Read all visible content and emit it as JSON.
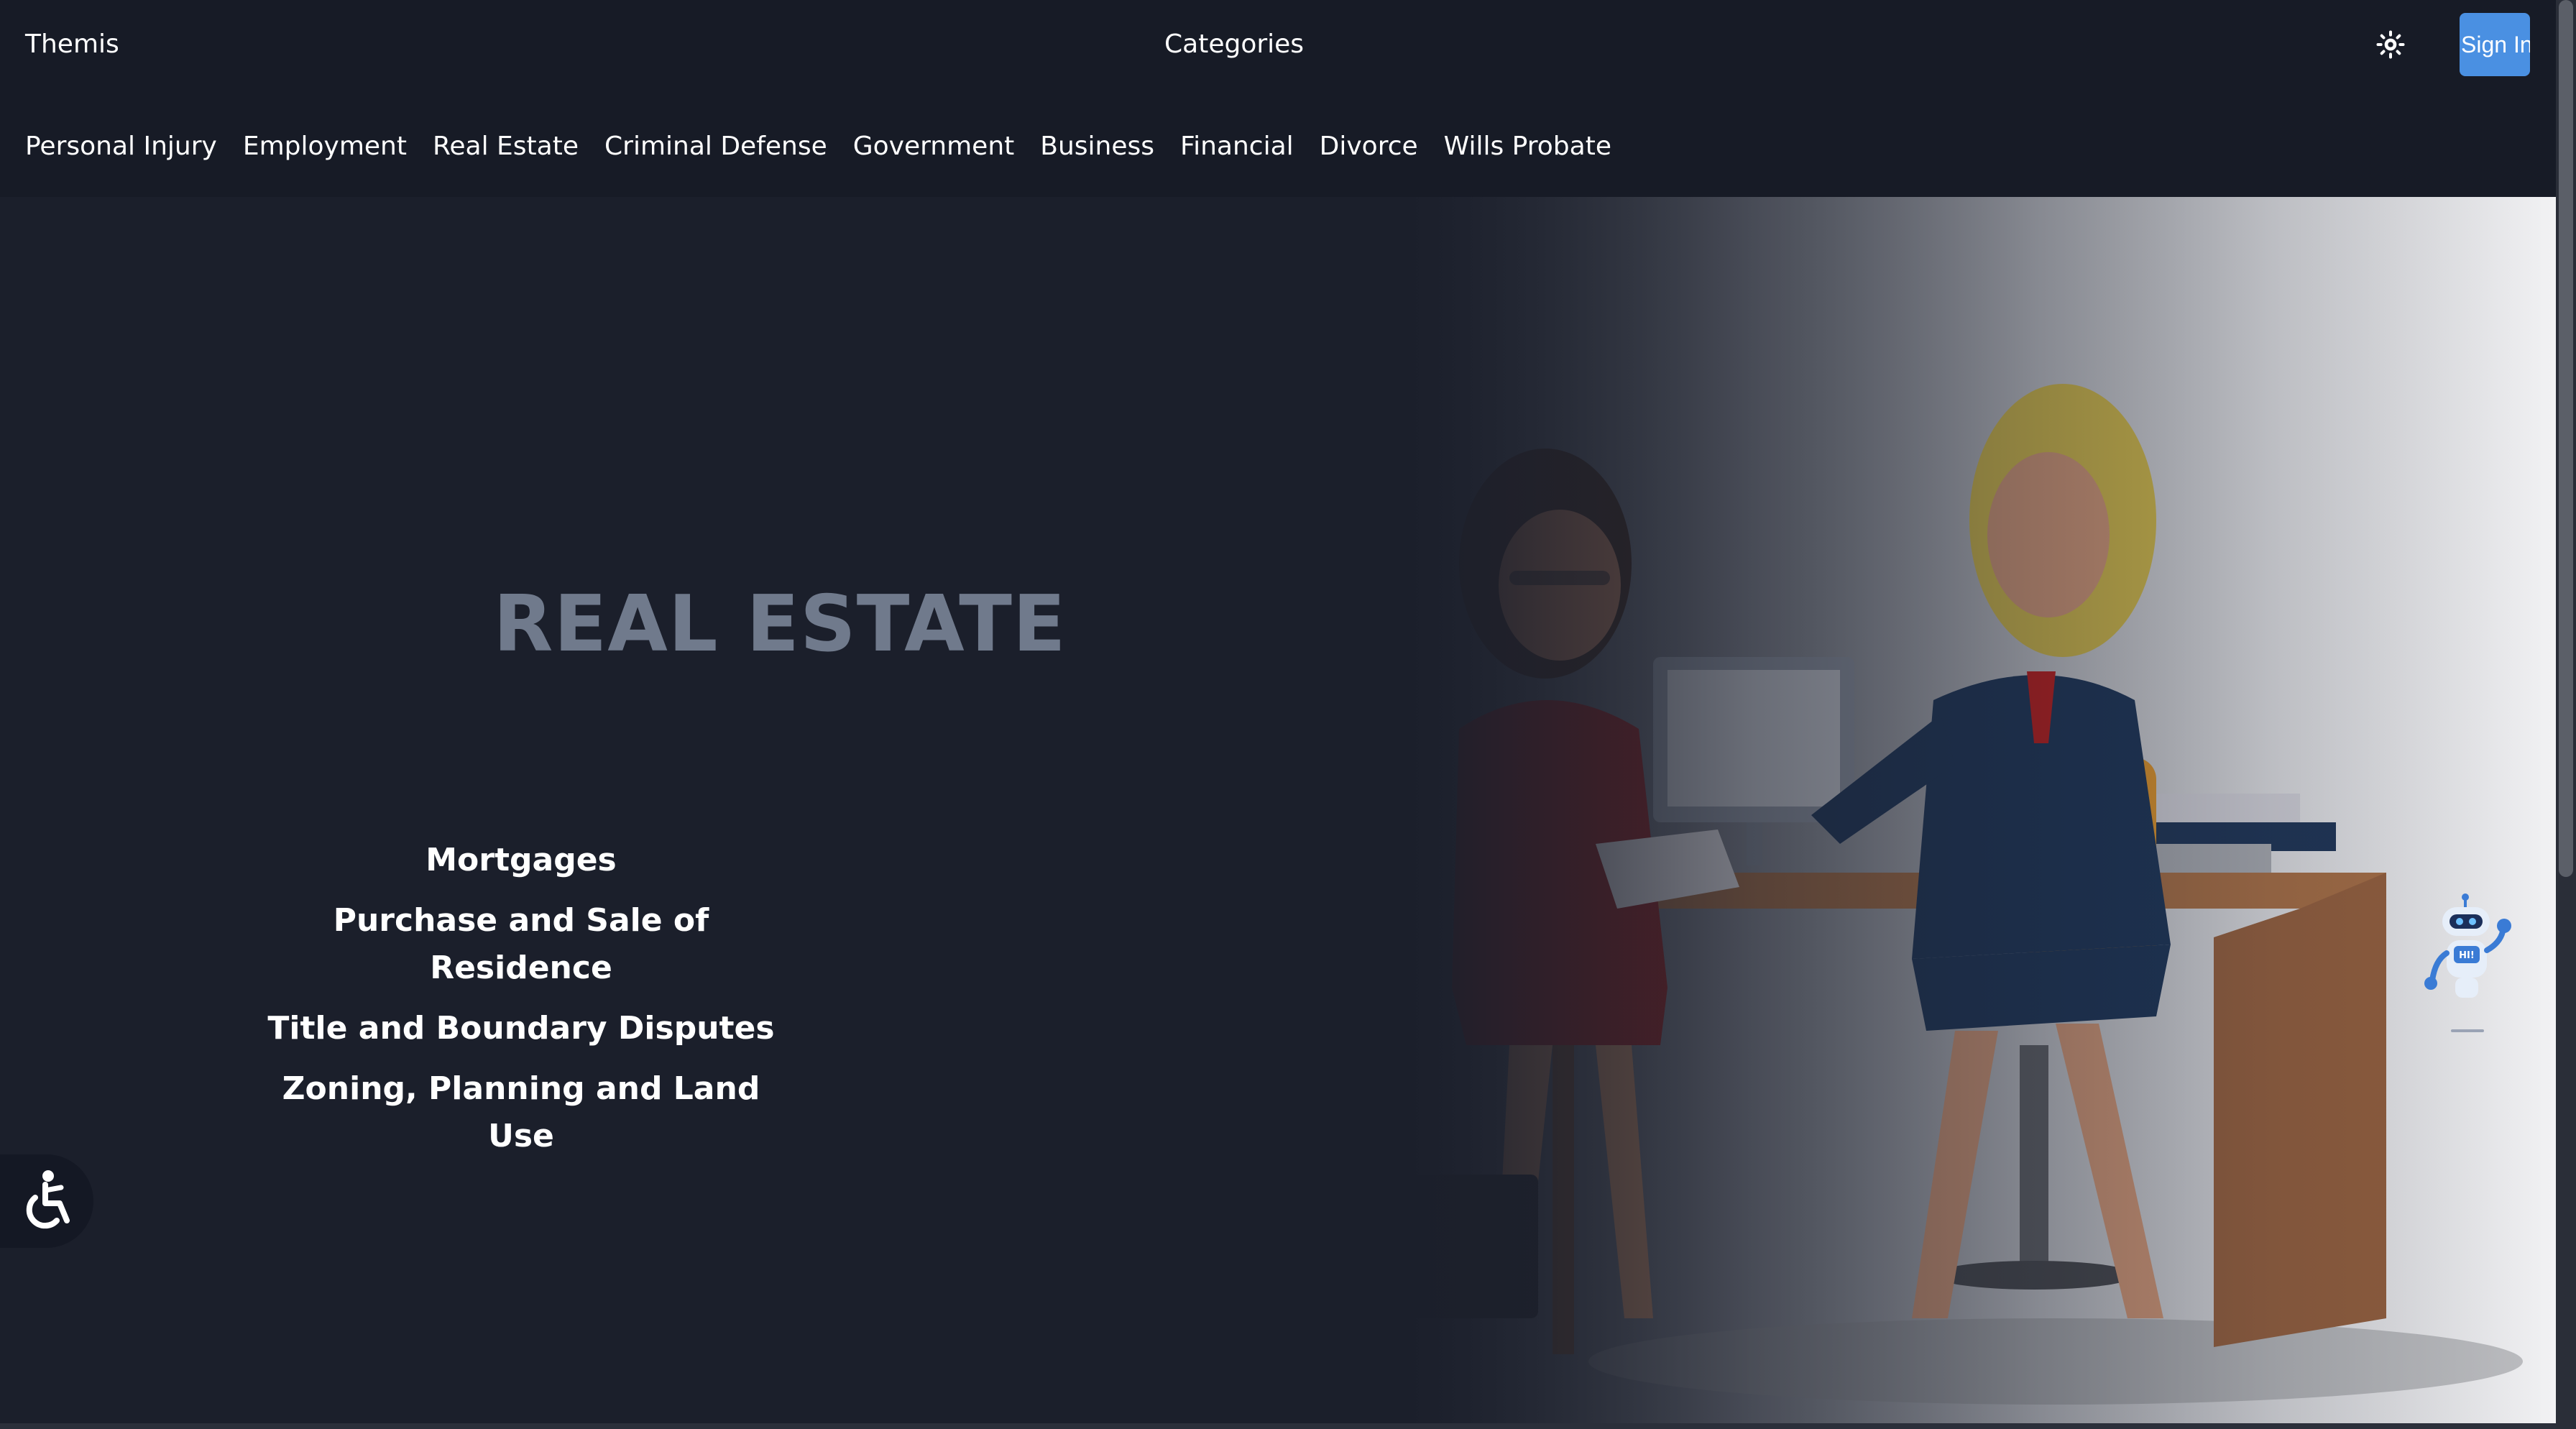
{
  "header": {
    "brand": "Themis",
    "categories_label": "Categories",
    "theme_icon": "sun-icon",
    "signin_label": "Sign In"
  },
  "nav": {
    "items": [
      {
        "label": "Personal Injury"
      },
      {
        "label": "Employment"
      },
      {
        "label": "Real Estate"
      },
      {
        "label": "Criminal Defense"
      },
      {
        "label": "Government"
      },
      {
        "label": "Business"
      },
      {
        "label": "Financial"
      },
      {
        "label": "Divorce"
      },
      {
        "label": "Wills Probate"
      }
    ]
  },
  "hero": {
    "title": "REAL ESTATE",
    "subcategories": [
      {
        "label": "Mortgages"
      },
      {
        "label": "Purchase and Sale of Residence"
      },
      {
        "label": "Title and Boundary Disputes"
      },
      {
        "label": "Zoning, Planning and Land Use"
      }
    ],
    "illustration": "two-women-at-office-desk-illustration"
  },
  "widgets": {
    "accessibility_icon": "accessibility-icon",
    "chatbot_icon": "chatbot-robot-icon",
    "chatbot_badge": "HI!"
  },
  "colors": {
    "background": "#1b1f2b",
    "header": "#171b26",
    "accent": "#4a90e2",
    "title": "#707a8c"
  }
}
